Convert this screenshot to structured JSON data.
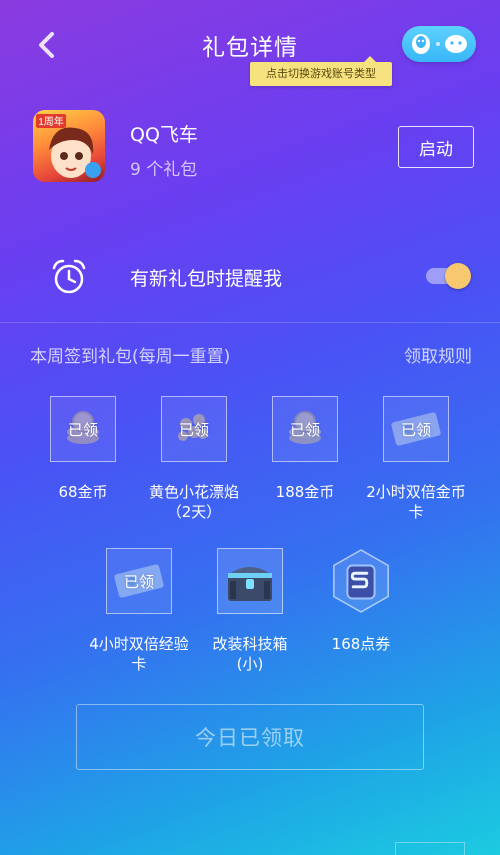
{
  "header": {
    "title": "礼包详情",
    "back_icon": "chevron-left-icon",
    "account_switch_icons": [
      "qq-penguin-icon",
      "wechat-icon"
    ],
    "tooltip": "点击切换游戏账号类型"
  },
  "game": {
    "name": "QQ飞车",
    "gift_count": "9 个礼包",
    "launch_label": "启动",
    "icon_badge": "1周年"
  },
  "reminder": {
    "label": "有新礼包时提醒我",
    "enabled": true,
    "icon": "alarm-clock-icon"
  },
  "weekly": {
    "title": "本周签到礼包(每周一重置)",
    "rules_label": "领取规则",
    "claimed_label": "已领",
    "items": [
      {
        "label": "68金币",
        "claimed": true,
        "icon": "gold-coins-icon"
      },
      {
        "label": "黄色小花漂焰（2天）",
        "claimed": true,
        "icon": "flower-flame-icon"
      },
      {
        "label": "188金币",
        "claimed": true,
        "icon": "gold-coins-icon"
      },
      {
        "label": "2小时双倍金币卡",
        "claimed": true,
        "icon": "ticket-card-icon"
      },
      {
        "label": "4小时双倍经验卡",
        "claimed": true,
        "icon": "ticket-card-icon"
      },
      {
        "label": "改装科技箱(小)",
        "claimed": false,
        "icon": "treasure-chest-icon"
      },
      {
        "label": "168点券",
        "claimed": false,
        "icon": "point-coupon-icon"
      }
    ]
  },
  "claim_button": {
    "label": "今日已领取"
  },
  "colors": {
    "accent_yellow": "#f7c86d",
    "tooltip_bg": "#f6e27e",
    "toggle_bg": "#38b7f6"
  }
}
